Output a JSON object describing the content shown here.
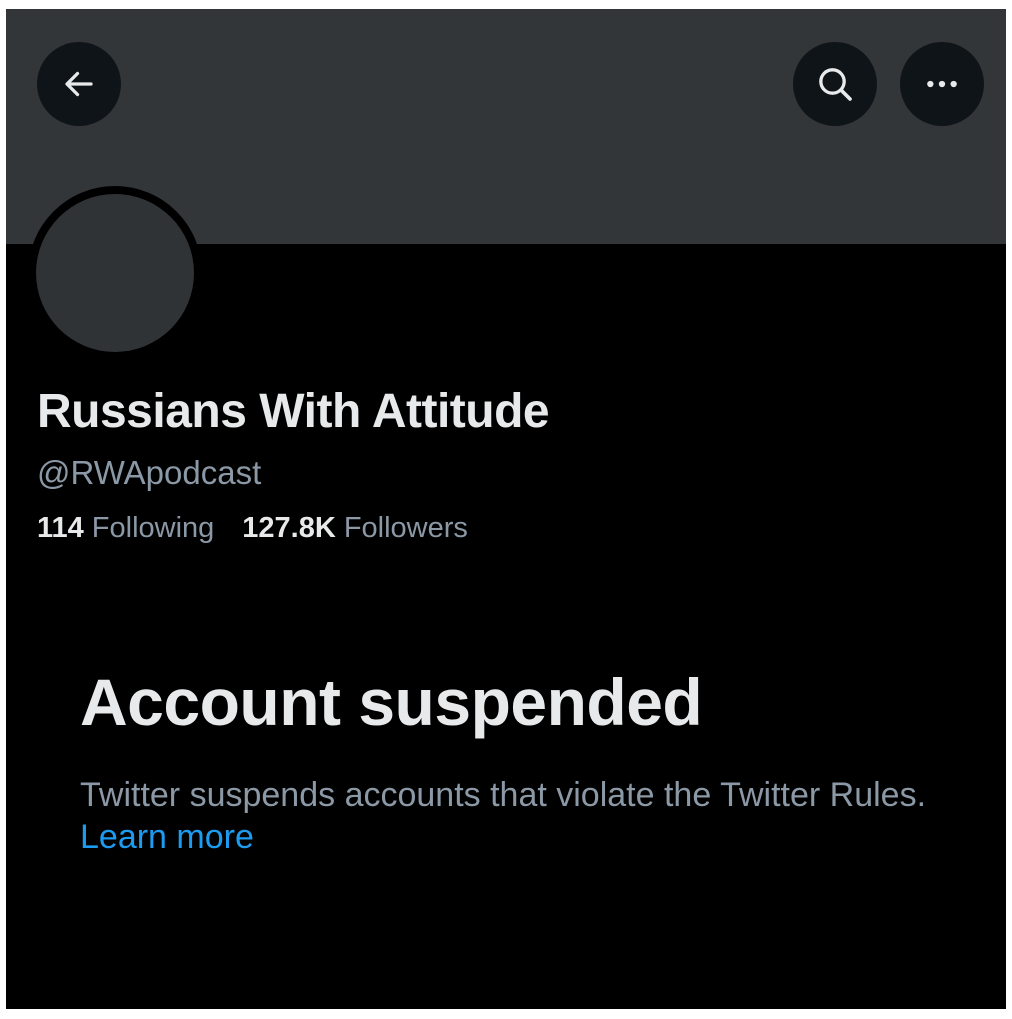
{
  "header": {
    "back_icon": "arrow-left-icon",
    "search_icon": "search-icon",
    "more_icon": "more-horizontal-icon"
  },
  "profile": {
    "display_name": "Russians With Attitude",
    "handle": "@RWApodcast",
    "following_count": "114",
    "following_label": "Following",
    "followers_count": "127.8K",
    "followers_label": "Followers"
  },
  "suspension": {
    "title": "Account suspended",
    "description": "Twitter suspends accounts that violate the Twitter Rules.",
    "link_label": "Learn more"
  },
  "colors": {
    "background": "#000000",
    "banner": "#333639",
    "primary_text": "#e7e9ea",
    "secondary_text": "#8b98a5",
    "link": "#1d9bf0"
  }
}
